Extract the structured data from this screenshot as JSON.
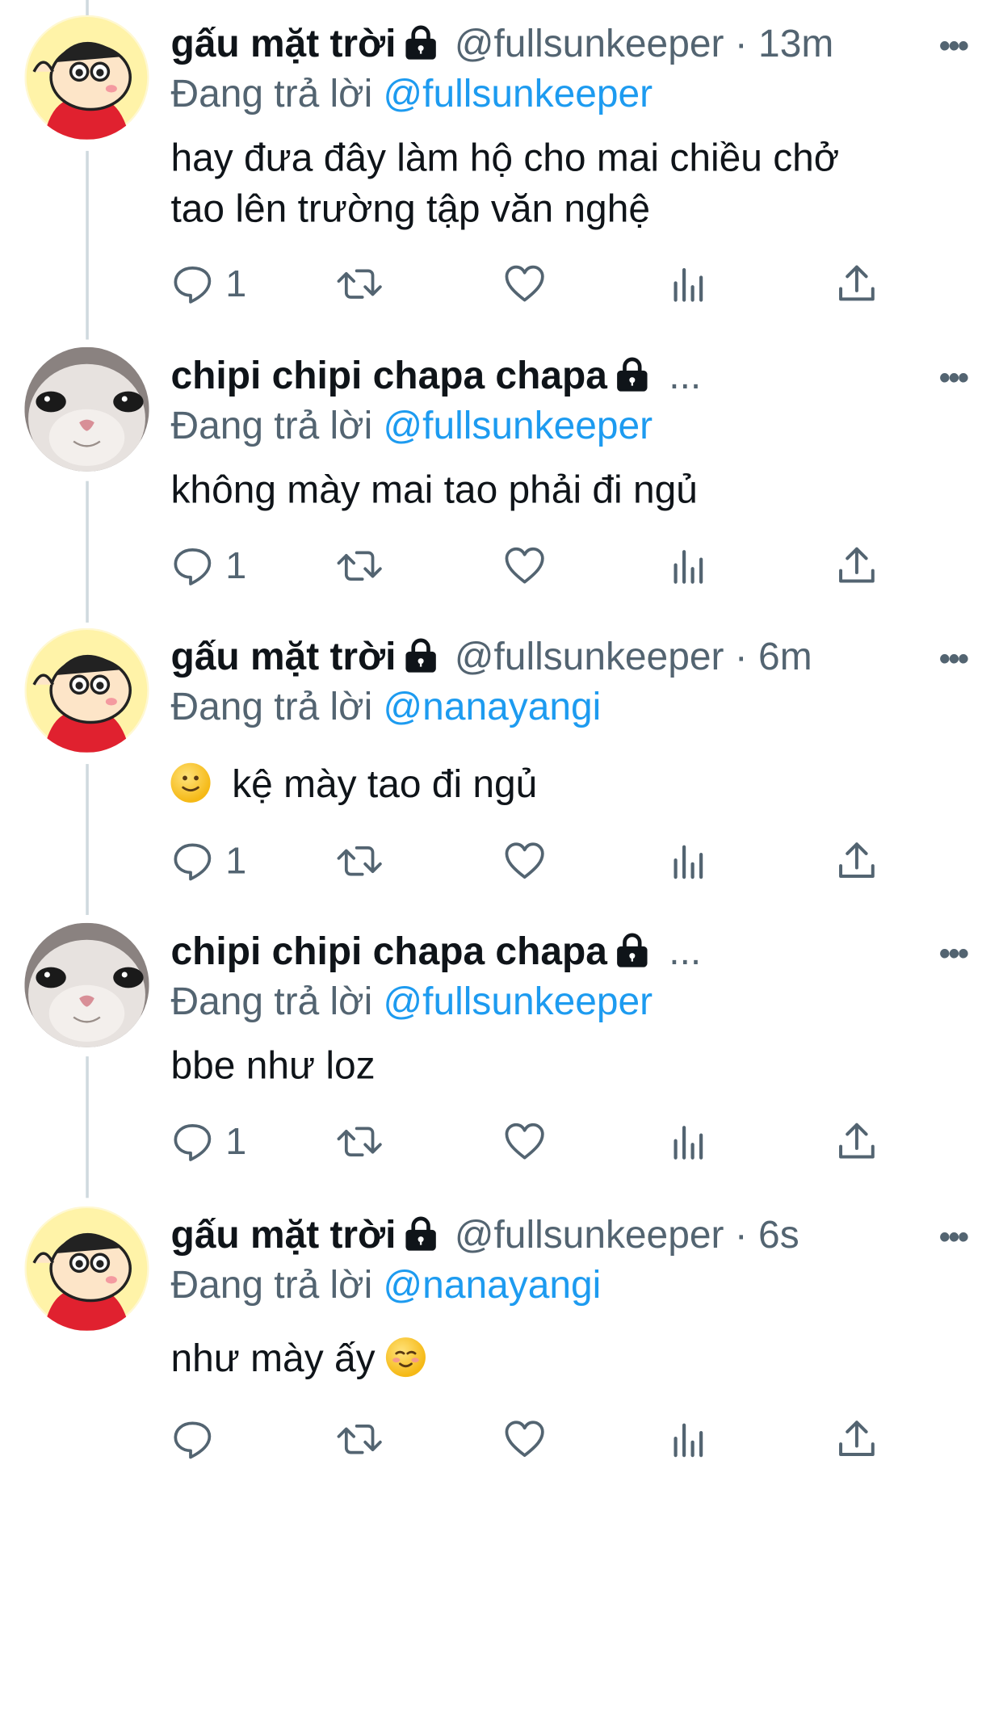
{
  "tweets": [
    {
      "author": "gấu mặt trời",
      "handle": "@fullsunkeeper",
      "time": "13m",
      "reply_prefix": "Đang trả lời",
      "reply_to": "@fullsunkeeper",
      "text_lines": [
        "hay đưa đây làm hộ cho mai chiều chở",
        "tao lên trường tập văn nghệ"
      ],
      "reply_count": "1",
      "avatar": "shinchan"
    },
    {
      "author": "chipi chipi chapa chapa",
      "truncation": "...",
      "reply_prefix": "Đang trả lời",
      "reply_to": "@fullsunkeeper",
      "text_lines": [
        "không mày mai tao phải đi ngủ"
      ],
      "reply_count": "1",
      "avatar": "cat"
    },
    {
      "author": "gấu mặt trời",
      "handle": "@fullsunkeeper",
      "time": "6m",
      "reply_prefix": "Đang trả lời",
      "reply_to": "@nanayangi",
      "text_lines": [
        "kệ mày tao đi ngủ"
      ],
      "leading_emoji": "slightly-smiling-face",
      "reply_count": "1",
      "avatar": "shinchan"
    },
    {
      "author": "chipi chipi chapa chapa",
      "truncation": "...",
      "reply_prefix": "Đang trả lời",
      "reply_to": "@fullsunkeeper",
      "text_lines": [
        "bbe như loz"
      ],
      "reply_count": "1",
      "avatar": "cat"
    },
    {
      "author": "gấu mặt trời",
      "handle": "@fullsunkeeper",
      "time": "6s",
      "reply_prefix": "Đang trả lời",
      "reply_to": "@nanayangi",
      "text_lines": [
        "như mày ấy"
      ],
      "trailing_emoji": "relieved-face",
      "reply_count": "",
      "avatar": "shinchan"
    }
  ],
  "separator": "·",
  "more_label": "•••",
  "icons": [
    "reply-icon",
    "retweet-icon",
    "like-icon",
    "analytics-icon",
    "share-icon",
    "lock-icon",
    "more-icon"
  ],
  "colors": {
    "link": "#1d9bf0",
    "text": "#0f1419",
    "muted": "#536471",
    "thread_line": "#cfd9de"
  }
}
